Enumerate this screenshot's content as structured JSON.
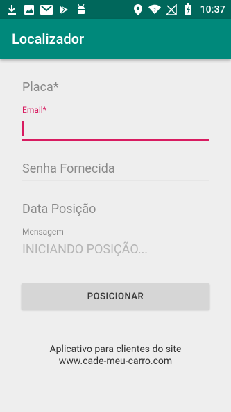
{
  "status_bar": {
    "time": "10:37",
    "left_icons": [
      "download-icon",
      "image-icon",
      "gmail-icon",
      "play-store-icon",
      "android-icon"
    ],
    "right_icons": [
      "location-icon",
      "wifi-icon",
      "no-signal-icon",
      "battery-charging-icon"
    ]
  },
  "app_bar": {
    "title": "Localizador"
  },
  "form": {
    "placa_placeholder": "Placa*",
    "email_label": "Email*",
    "email_value": "",
    "senha_placeholder": "Senha Fornecida",
    "data_posicao_placeholder": "Data Posição",
    "mensagem_label": "Mensagem",
    "mensagem_value": "INICIANDO POSIÇÃO..."
  },
  "actions": {
    "posicionar_label": "POSICIONAR"
  },
  "footer": {
    "line1": "Aplicativo para clientes do site",
    "line2": "www.cade-meu-carro.com"
  },
  "colors": {
    "status_bar": "#00675b",
    "app_bar": "#00897b",
    "accent": "#d81b60"
  }
}
